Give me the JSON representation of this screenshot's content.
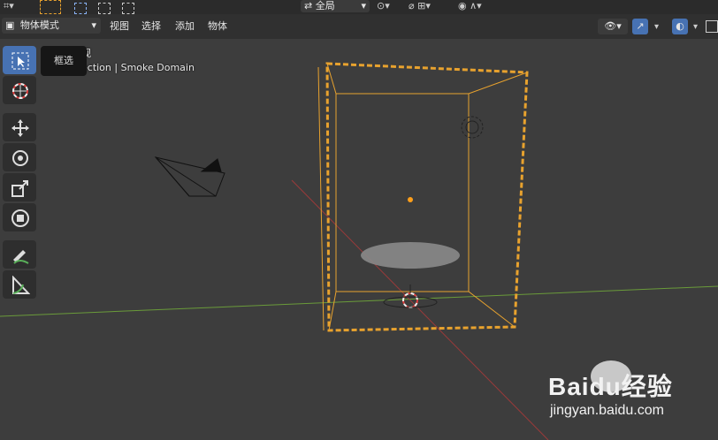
{
  "topbar": {
    "view_selector": "全局"
  },
  "header": {
    "mode": "物体模式",
    "menus": [
      "视图",
      "选择",
      "添加",
      "物体"
    ]
  },
  "tooltip": "框选",
  "viewport": {
    "view_name": "视",
    "collection_info": "ection | Smoke Domain"
  },
  "watermark": {
    "brand": "Baidu经验",
    "url": "jingyan.baidu.com"
  },
  "colors": {
    "selection": "#e8a22e",
    "x_axis": "#9b3a3a",
    "y_axis": "#6a9b3a",
    "active_tool": "#4772b3"
  }
}
